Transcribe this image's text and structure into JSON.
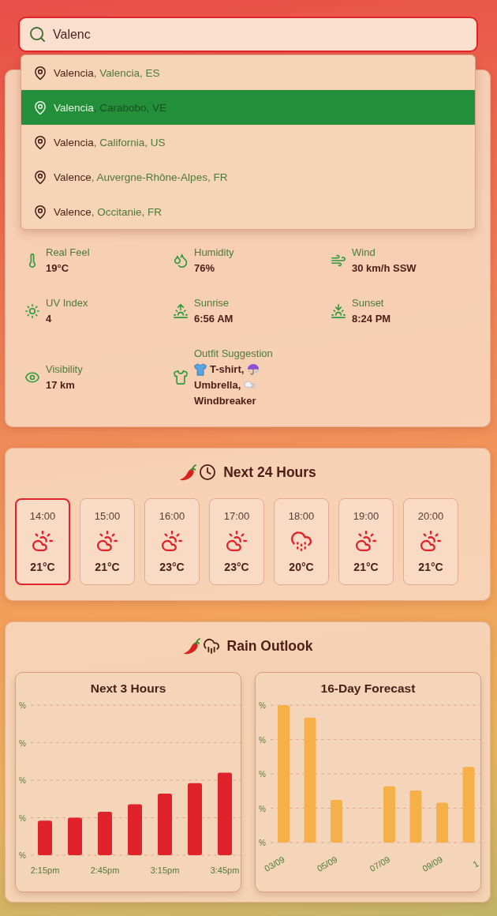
{
  "search": {
    "value": "Valenc"
  },
  "suggestions": [
    {
      "city": "Valencia",
      "region": ", Valencia, ES",
      "selected": false
    },
    {
      "city": "Valencia",
      "region": ", Carabobo, VE",
      "selected": true
    },
    {
      "city": "Valencia",
      "region": ", California, US",
      "selected": false
    },
    {
      "city": "Valence",
      "region": ", Auvergne-Rhône-Alpes, FR",
      "selected": false
    },
    {
      "city": "Valence",
      "region": ", Occitanie, FR",
      "selected": false
    }
  ],
  "stats": [
    {
      "kind": "real_feel",
      "label": "Real Feel",
      "value": "19°C"
    },
    {
      "kind": "humidity",
      "label": "Humidity",
      "value": "76%"
    },
    {
      "kind": "wind",
      "label": "Wind",
      "value": "30 km/h SSW"
    },
    {
      "kind": "uv",
      "label": "UV Index",
      "value": "4"
    },
    {
      "kind": "sunrise",
      "label": "Sunrise",
      "value": "6:56 AM"
    },
    {
      "kind": "sunset",
      "label": "Sunset",
      "value": "8:24 PM"
    },
    {
      "kind": "visibility",
      "label": "Visibility",
      "value": "17 km"
    },
    {
      "kind": "outfit",
      "label": "Outfit Suggestion",
      "items": [
        {
          "kind": "tshirt",
          "text": "T-shirt,"
        },
        {
          "kind": "umbrella",
          "text": "Umbrella,"
        },
        {
          "kind": "wind",
          "text": "Windbreaker"
        }
      ]
    }
  ],
  "hourly": {
    "title": "Next 24 Hours",
    "hours": [
      {
        "time": "14:00",
        "kind": "partly_cloudy",
        "temp": "21°C",
        "selected": true
      },
      {
        "time": "15:00",
        "kind": "partly_cloudy",
        "temp": "21°C",
        "selected": false
      },
      {
        "time": "16:00",
        "kind": "partly_cloudy",
        "temp": "23°C",
        "selected": false
      },
      {
        "time": "17:00",
        "kind": "partly_cloudy",
        "temp": "23°C",
        "selected": false
      },
      {
        "time": "18:00",
        "kind": "rain",
        "temp": "20°C",
        "selected": false
      },
      {
        "time": "19:00",
        "kind": "partly_cloudy",
        "temp": "21°C",
        "selected": false
      },
      {
        "time": "20:00",
        "kind": "partly_cloudy",
        "temp": "21°C",
        "selected": false
      }
    ]
  },
  "rain_outlook": {
    "title": "Rain Outlook",
    "charts": [
      {
        "title": "Next 3 Hours",
        "y_tick_labels": [
          "%",
          "%",
          "%",
          "%",
          "%"
        ],
        "x_labels": [
          "2:15pm",
          "2:45pm",
          "3:15pm",
          "3:45pm"
        ]
      },
      {
        "title": "16-Day Forecast",
        "y_tick_labels": [
          "%",
          "%",
          "%",
          "%",
          "%"
        ],
        "x_labels": [
          "03/09",
          "05/09",
          "07/09",
          "09/09",
          "1"
        ]
      }
    ]
  }
}
